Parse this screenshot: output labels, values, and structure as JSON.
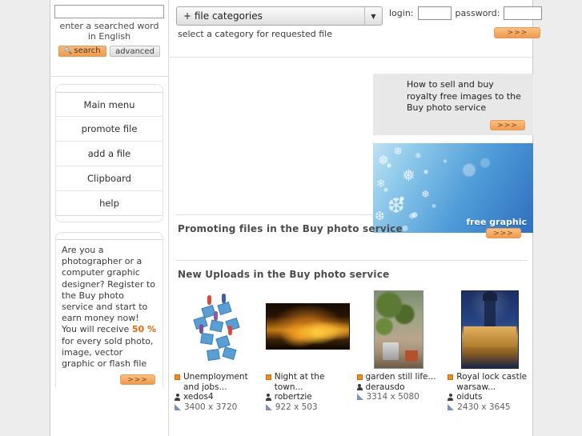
{
  "search": {
    "input_value": "",
    "hint": "enter a searched word in English",
    "search_label": "search",
    "advanced_label": "advanced",
    "search_icon": "magnifier-icon"
  },
  "menu": {
    "items": [
      {
        "label": "Main menu"
      },
      {
        "label": "promote file"
      },
      {
        "label": "add a file"
      },
      {
        "label": "Clipboard"
      },
      {
        "label": "help"
      }
    ]
  },
  "side_promo": {
    "text_before": "Are you a photographer or a computer graphic designer? Register to the Buy photo service and start to earn money now! You will receive ",
    "percent": "50 %",
    "text_after": " for every sold photo, image, vector graphic or flash file",
    "button_label": ">>>"
  },
  "header": {
    "category_select": "+ file categories",
    "category_hint": "select a category for requested file",
    "dropdown_icon": "chevron-down-icon",
    "login_label": "login:",
    "login_value": "",
    "password_label": "password:",
    "password_value": "",
    "submit_label": ">>>"
  },
  "banner": {
    "promo_text": "How to sell and buy royalty free images to the Buy photo service",
    "promo_button": ">>>",
    "free_graphic_label": "free graphic"
  },
  "sections": {
    "promoting_title": "Promoting files in the Buy photo service",
    "promoting_button": ">>>",
    "new_uploads_title": "New Uploads in the Buy photo service"
  },
  "uploads": [
    {
      "title": "Unemployment and jobs...",
      "author": "xedos4",
      "dimensions": "3400 x 3720",
      "thumb": "jobs-illustration-thumb"
    },
    {
      "title": "Night at the town...",
      "author": "robertzie",
      "dimensions": "922 x 503",
      "thumb": "night-town-thumb"
    },
    {
      "title": "garden still life...",
      "author": "derausdo",
      "dimensions": "3314 x 5080",
      "thumb": "garden-still-life-thumb"
    },
    {
      "title": "Royal lock castle warsaw...",
      "author": "oiduts",
      "dimensions": "2430 x 3645",
      "thumb": "royal-castle-thumb"
    }
  ],
  "colors": {
    "accent_orange": "#f08a22",
    "page_bg": "#ededed",
    "banner_blue": "#2f6fc0"
  }
}
